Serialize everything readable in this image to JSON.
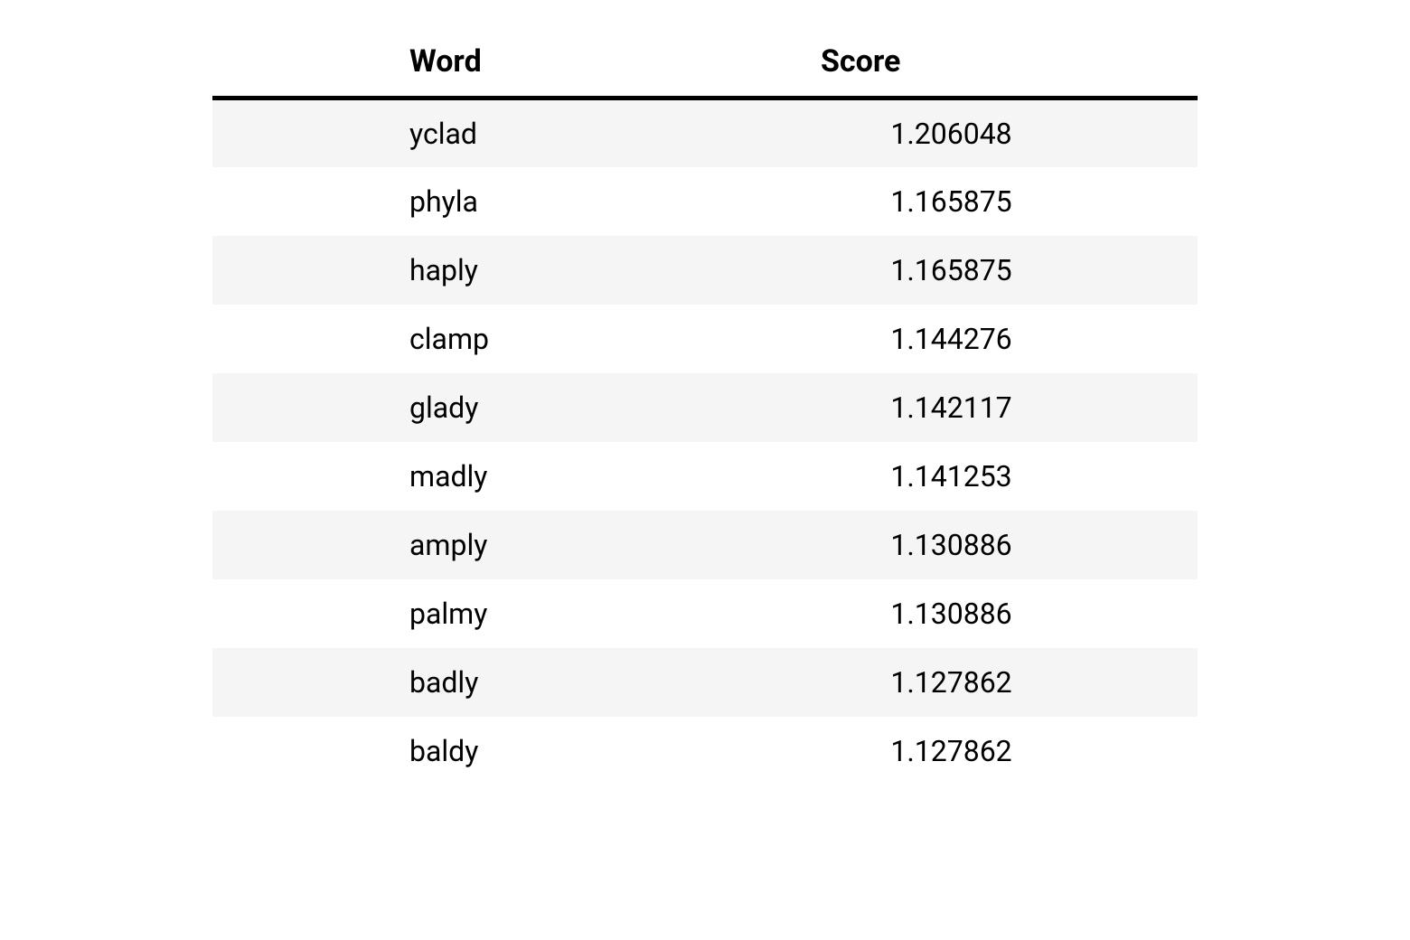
{
  "chart_data": {
    "type": "table",
    "columns": [
      "Word",
      "Score"
    ],
    "rows": [
      {
        "word": "yclad",
        "score": 1.206048
      },
      {
        "word": "phyla",
        "score": 1.165875
      },
      {
        "word": "haply",
        "score": 1.165875
      },
      {
        "word": "clamp",
        "score": 1.144276
      },
      {
        "word": "glady",
        "score": 1.142117
      },
      {
        "word": "madly",
        "score": 1.141253
      },
      {
        "word": "amply",
        "score": 1.130886
      },
      {
        "word": "palmy",
        "score": 1.130886
      },
      {
        "word": "badly",
        "score": 1.127862
      },
      {
        "word": "baldy",
        "score": 1.127862
      }
    ]
  },
  "headers": {
    "word": "Word",
    "score": "Score"
  },
  "rows": [
    {
      "word": "yclad",
      "score": "1.206048"
    },
    {
      "word": "phyla",
      "score": "1.165875"
    },
    {
      "word": "haply",
      "score": "1.165875"
    },
    {
      "word": "clamp",
      "score": "1.144276"
    },
    {
      "word": "glady",
      "score": "1.142117"
    },
    {
      "word": "madly",
      "score": "1.141253"
    },
    {
      "word": "amply",
      "score": "1.130886"
    },
    {
      "word": "palmy",
      "score": "1.130886"
    },
    {
      "word": "badly",
      "score": "1.127862"
    },
    {
      "word": "baldy",
      "score": "1.127862"
    }
  ]
}
